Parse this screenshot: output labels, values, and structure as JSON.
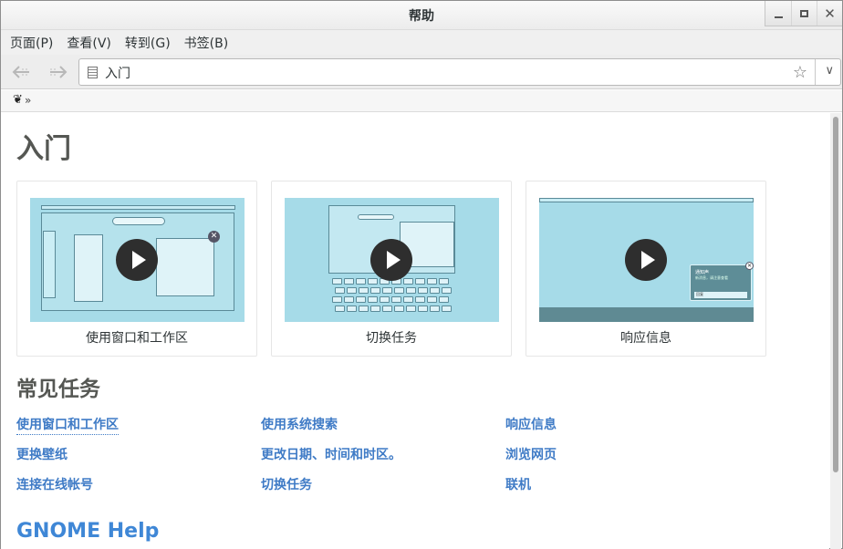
{
  "window": {
    "title": "帮助"
  },
  "menu": [
    "页面(P)",
    "查看(V)",
    "转到(G)",
    "书签(B)"
  ],
  "address": {
    "text": "入门"
  },
  "page": {
    "title": "入门",
    "videos": [
      {
        "caption": "使用窗口和工作区"
      },
      {
        "caption": "切换任务"
      },
      {
        "caption": "响应信息"
      }
    ],
    "notify_title": "通知声",
    "notify_body": "新消息，请注意查看",
    "notify_reply": "回复",
    "section_title": "常见任务",
    "tasks": [
      {
        "label": "使用窗口和工作区"
      },
      {
        "label": "使用系统搜索"
      },
      {
        "label": "响应信息"
      },
      {
        "label": "更换壁纸"
      },
      {
        "label": "更改日期、时间和时区。"
      },
      {
        "label": "浏览网页"
      },
      {
        "label": "连接在线帐号"
      },
      {
        "label": "切换任务"
      },
      {
        "label": "联机"
      }
    ],
    "footer_heading": "GNOME Help"
  },
  "icons": {
    "back": "go-back-icon",
    "forward": "go-forward-icon",
    "bookmark": "star-icon",
    "dropdown": "chevron-down-icon",
    "crumb": "gnome-foot-icon"
  },
  "colors": {
    "link": "#3f7bc6",
    "thumb_bg": "#a6dbe8",
    "heading": "#555753"
  }
}
